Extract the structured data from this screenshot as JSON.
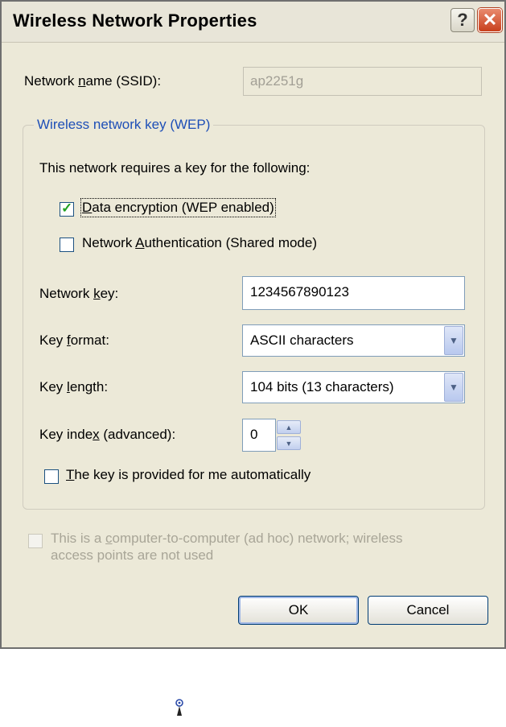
{
  "window": {
    "title": "Wireless Network Properties",
    "help_glyph": "?",
    "close_glyph": "✕"
  },
  "ssid": {
    "label_pre": "Network ",
    "label_u": "n",
    "label_post": "ame (SSID):",
    "value": "ap2251g"
  },
  "wep": {
    "group_title": "Wireless network key (WEP)",
    "intro": "This network requires a key for the following:",
    "data_encryption": {
      "pre": "",
      "u": "D",
      "post": "ata encryption (WEP enabled)",
      "checked": true
    },
    "network_auth": {
      "pre": "Network ",
      "u": "A",
      "post": "uthentication (Shared mode)",
      "checked": false
    },
    "network_key": {
      "label_pre": "Network ",
      "label_u": "k",
      "label_post": "ey:",
      "value": "1234567890123"
    },
    "key_format": {
      "label_pre": "Key ",
      "label_u": "f",
      "label_post": "ormat:",
      "value": "ASCII characters"
    },
    "key_length": {
      "label_pre": "Key ",
      "label_u": "l",
      "label_post": "ength:",
      "value": "104 bits (13 characters)"
    },
    "key_index": {
      "label_pre": "Key inde",
      "label_u": "x",
      "label_post": " (advanced):",
      "value": "0"
    },
    "auto_key": {
      "pre": "",
      "u": "T",
      "post": "he key is provided for me automatically",
      "checked": false
    }
  },
  "adhoc": {
    "line1_pre": "This is a ",
    "line1_u": "c",
    "line1_post": "omputer-to-computer (ad hoc) network; wireless",
    "line2": "access points are not used",
    "checked": false,
    "enabled": false
  },
  "buttons": {
    "ok": "OK",
    "cancel": "Cancel"
  },
  "colors": {
    "dialog_bg": "#ece9d8",
    "group_title": "#1e4fb7",
    "close_button": "#c8401d",
    "check_mark": "#21a121"
  },
  "icons": {
    "help": "help-icon",
    "close": "close-icon",
    "dropdown": "chevron-down-icon",
    "spin_up": "spin-up-icon",
    "spin_down": "spin-down-icon",
    "cursor": "wireless-antenna-icon"
  }
}
